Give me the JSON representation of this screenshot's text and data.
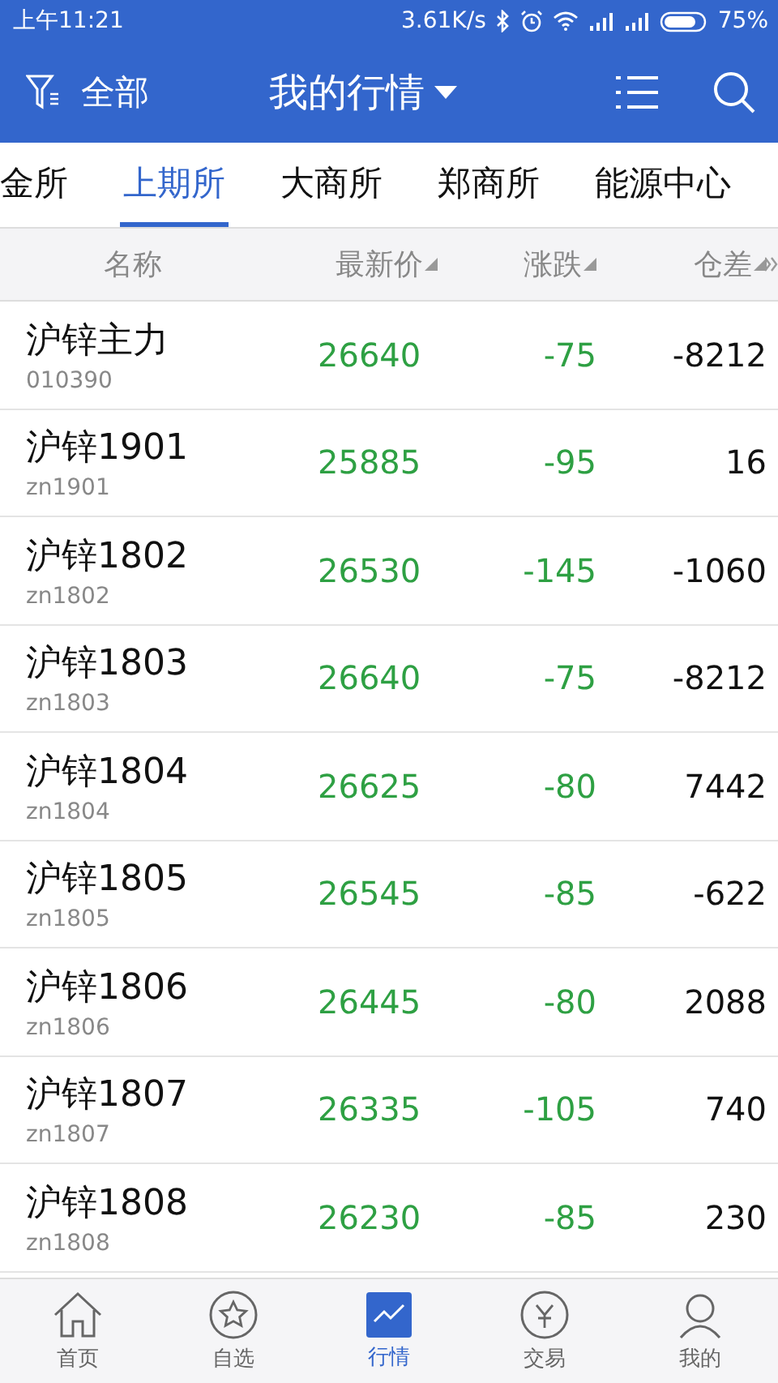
{
  "status_bar": {
    "time": "上午11:21",
    "speed": "3.61K/s",
    "battery": "75%"
  },
  "header": {
    "filter_label": "全部",
    "title": "我的行情"
  },
  "tabs": [
    {
      "label": "金所",
      "selected": false
    },
    {
      "label": "上期所",
      "selected": true
    },
    {
      "label": "大商所",
      "selected": false
    },
    {
      "label": "郑商所",
      "selected": false
    },
    {
      "label": "能源中心",
      "selected": false
    }
  ],
  "table": {
    "columns": [
      {
        "label": "名称",
        "sortable": false
      },
      {
        "label": "最新价",
        "sortable": true
      },
      {
        "label": "涨跌",
        "sortable": true
      },
      {
        "label": "仓差",
        "sortable": true
      }
    ],
    "rows": [
      {
        "name": "沪锌主力",
        "code": "010390",
        "price": "26640",
        "change": "-75",
        "diff": "-8212"
      },
      {
        "name": "沪锌1901",
        "code": "zn1901",
        "price": "25885",
        "change": "-95",
        "diff": "16"
      },
      {
        "name": "沪锌1802",
        "code": "zn1802",
        "price": "26530",
        "change": "-145",
        "diff": "-1060"
      },
      {
        "name": "沪锌1803",
        "code": "zn1803",
        "price": "26640",
        "change": "-75",
        "diff": "-8212"
      },
      {
        "name": "沪锌1804",
        "code": "zn1804",
        "price": "26625",
        "change": "-80",
        "diff": "7442"
      },
      {
        "name": "沪锌1805",
        "code": "zn1805",
        "price": "26545",
        "change": "-85",
        "diff": "-622"
      },
      {
        "name": "沪锌1806",
        "code": "zn1806",
        "price": "26445",
        "change": "-80",
        "diff": "2088"
      },
      {
        "name": "沪锌1807",
        "code": "zn1807",
        "price": "26335",
        "change": "-105",
        "diff": "740"
      },
      {
        "name": "沪锌1808",
        "code": "zn1808",
        "price": "26230",
        "change": "-85",
        "diff": "230"
      }
    ]
  },
  "bottom_nav": [
    {
      "label": "首页",
      "kind": "home",
      "selected": false
    },
    {
      "label": "自选",
      "kind": "star",
      "selected": false
    },
    {
      "label": "行情",
      "kind": "chart",
      "selected": true
    },
    {
      "label": "交易",
      "kind": "trade",
      "selected": false
    },
    {
      "label": "我的",
      "kind": "user",
      "selected": false
    }
  ]
}
